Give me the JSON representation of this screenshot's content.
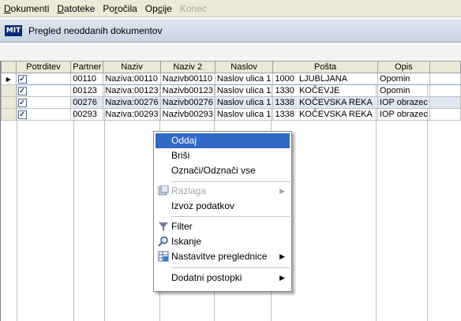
{
  "menubar": {
    "items": [
      {
        "label": "Dokumenti",
        "u": "D",
        "rest": "okumenti"
      },
      {
        "label": "Datoteke",
        "u": "D",
        "rest": "atoteke"
      },
      {
        "label": "Poročila",
        "pre": "Po",
        "u": "r",
        "rest": "očila"
      },
      {
        "label": "Opcije",
        "pre": "Op",
        "u": "c",
        "rest": "ije"
      },
      {
        "label": "Konec"
      }
    ]
  },
  "window": {
    "icon_text": "MIT",
    "title": "Pregled neoddanih dokumentov"
  },
  "grid": {
    "columns": [
      "Potrditev",
      "Partner",
      "Naziv",
      "Naziv 2",
      "Naslov",
      "Pošta",
      "Opis"
    ],
    "rows": [
      {
        "checked": "✓",
        "partner": "00110",
        "naziv": "Naziva:00110",
        "naziv2": "Nazivb00110",
        "naslov": "Naslov ulica 1",
        "posta_num": "1000",
        "posta": "LJUBLJANA",
        "opis": "Opomin"
      },
      {
        "checked": "✓",
        "partner": "00123",
        "naziv": "Naziva:00123",
        "naziv2": "Nazivb00123",
        "naslov": "Naslov ulica 1",
        "posta_num": "1330",
        "posta": "KOČEVJE",
        "opis": "Opomin"
      },
      {
        "checked": "✓",
        "partner": "00276",
        "naziv": "Naziva:00276",
        "naziv2": "Nazivb00276",
        "naslov": "Naslov ulica 1",
        "posta_num": "1338",
        "posta": "KOČEVSKA REKA",
        "opis": "IOP obrazec"
      },
      {
        "checked": "✓",
        "partner": "00293",
        "naziv": "Naziva:00293",
        "naziv2": "Nazivb00293",
        "naslov": "Naslov ulica 1",
        "posta_num": "1338",
        "posta": "KOČEVSKA REKA",
        "opis": "IOP obrazec"
      }
    ]
  },
  "context_menu": {
    "items": [
      {
        "label": "Oddaj",
        "highlighted": true
      },
      {
        "label": "Briši"
      },
      {
        "label": "Označi/Odznači vse"
      },
      {
        "label": "Razlaga",
        "disabled": true,
        "submenu": "▶",
        "icon": "info-icon"
      },
      {
        "label": "Izvoz podatkov"
      },
      {
        "label": "Filter",
        "icon": "filter-icon"
      },
      {
        "label": "Iskanje",
        "icon": "search-icon"
      },
      {
        "label": "Nastavitve preglednice",
        "submenu": "▶",
        "icon": "grid-settings-icon"
      },
      {
        "label": "Dodatni postopki",
        "submenu": "▶"
      }
    ]
  }
}
